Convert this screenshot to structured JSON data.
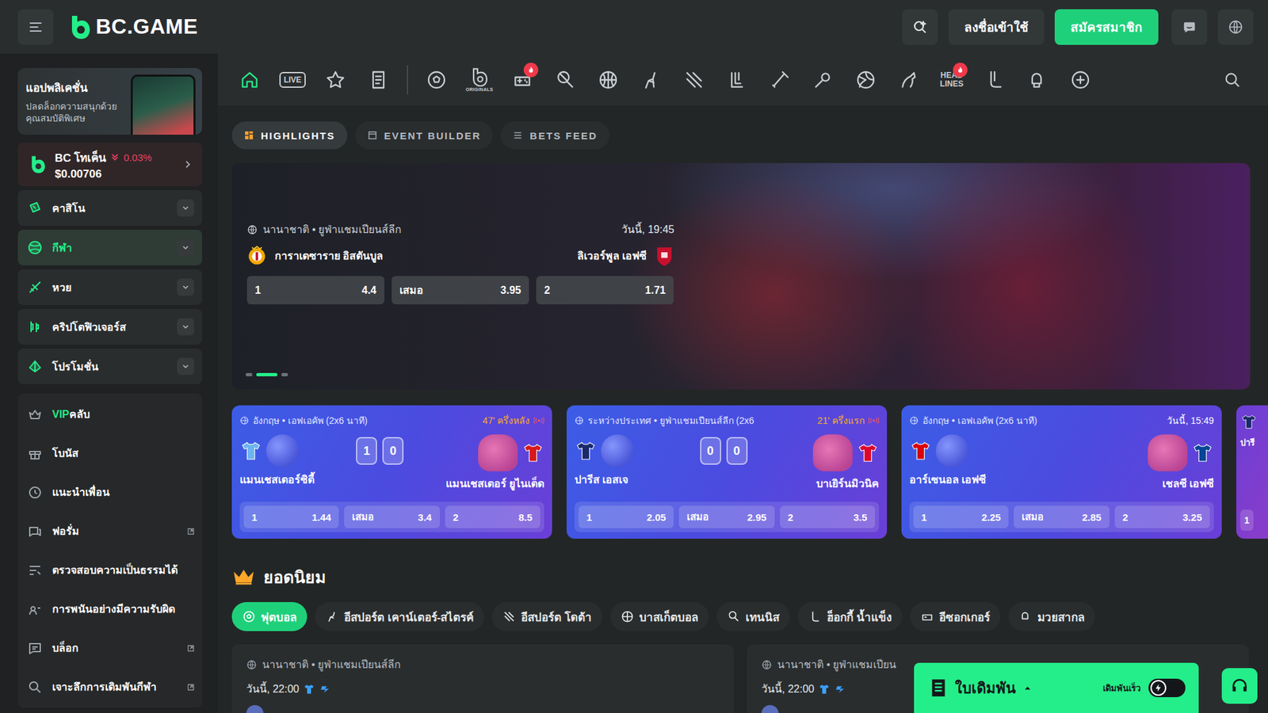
{
  "header": {
    "logo": "BC.GAME",
    "login": "ลงชื่อเข้าใช้",
    "signup": "สมัครสมาชิก"
  },
  "sidebar": {
    "app_promo": {
      "title": "แอปพลิเคชั่น",
      "subtitle": "ปลดล็อกความสนุกด้วยคุณสมบัติพิเศษ"
    },
    "token": {
      "name": "BC โทเค็น",
      "change": "0.03%",
      "price": "$0.00706",
      "falling": true
    },
    "groups": [
      {
        "label": "คาสิโน",
        "selected": false,
        "expanded": false
      },
      {
        "label": "กีฬา",
        "selected": true,
        "expanded": false
      },
      {
        "label": "หวย",
        "selected": false,
        "expanded": false
      },
      {
        "label": "คริปโตฟิวเจอร์ส",
        "selected": false,
        "expanded": false
      },
      {
        "label": "โปรโมชั่น",
        "selected": false,
        "expanded": false
      }
    ],
    "links": [
      {
        "accent": "VIP",
        "label": "คลับ",
        "external": false
      },
      {
        "accent": "",
        "label": "โบนัส",
        "external": false
      },
      {
        "accent": "",
        "label": "แนะนำเพื่อน",
        "external": false
      },
      {
        "accent": "",
        "label": "ฟอรั่ม",
        "external": true
      },
      {
        "accent": "",
        "label": "ตรวจสอบความเป็นธรรมได้",
        "external": false
      },
      {
        "accent": "",
        "label": "การพนันอย่างมีความรับผิด",
        "external": false
      },
      {
        "accent": "",
        "label": "บล็อก",
        "external": true
      },
      {
        "accent": "",
        "label": "เจาะลึกการเดิมพันกีฬา",
        "external": true
      }
    ]
  },
  "sports_nav": [
    {
      "kind": "home",
      "label": "",
      "selected": true,
      "hot": false
    },
    {
      "kind": "live",
      "label": "LIVE",
      "selected": false,
      "hot": false
    },
    {
      "kind": "star",
      "label": "",
      "selected": false,
      "hot": false
    },
    {
      "kind": "slip",
      "label": "",
      "selected": false,
      "hot": false
    },
    {
      "kind": "soccer",
      "label": "",
      "selected": false,
      "hot": false
    },
    {
      "kind": "originals",
      "label": "ORIGINALS",
      "selected": false,
      "hot": false
    },
    {
      "kind": "fifa",
      "label": "",
      "selected": false,
      "hot": true
    },
    {
      "kind": "tennis",
      "label": "",
      "selected": false,
      "hot": false
    },
    {
      "kind": "basketball",
      "label": "",
      "selected": false,
      "hot": false
    },
    {
      "kind": "cs",
      "label": "",
      "selected": false,
      "hot": false
    },
    {
      "kind": "dota",
      "label": "",
      "selected": false,
      "hot": false
    },
    {
      "kind": "lol",
      "label": "",
      "selected": false,
      "hot": false
    },
    {
      "kind": "cricket",
      "label": "",
      "selected": false,
      "hot": false
    },
    {
      "kind": "badminton",
      "label": "",
      "selected": false,
      "hot": false
    },
    {
      "kind": "volleyball",
      "label": "",
      "selected": false,
      "hot": false
    },
    {
      "kind": "horse",
      "label": "",
      "selected": false,
      "hot": false
    },
    {
      "kind": "headlines",
      "label": "HEAD LINES",
      "selected": false,
      "hot": true
    },
    {
      "kind": "hockey",
      "label": "",
      "selected": false,
      "hot": false
    },
    {
      "kind": "boxing",
      "label": "",
      "selected": false,
      "hot": false
    },
    {
      "kind": "more",
      "label": "",
      "selected": false,
      "hot": false
    }
  ],
  "tabs": [
    {
      "label": "HIGHLIGHTS",
      "selected": true
    },
    {
      "label": "EVENT BUILDER",
      "selected": false
    },
    {
      "label": "BETS FEED",
      "selected": false
    }
  ],
  "hero": {
    "league": "นานาชาติ • ยูฟ่าแชมเปียนส์ลีก",
    "time": "วันนี้, 19:45",
    "home": "การาเดซาราย อิสตันบูล",
    "away": "ลิเวอร์พูล เอฟซี",
    "home_color": "#f4a900",
    "away_color": "#c8102e",
    "odds": [
      {
        "label": "1",
        "value": "4.4"
      },
      {
        "label": "เสมอ",
        "value": "3.95"
      },
      {
        "label": "2",
        "value": "1.71"
      }
    ],
    "dots": [
      {
        "selected": false
      },
      {
        "selected": true
      },
      {
        "selected": false
      }
    ]
  },
  "match_cards": [
    {
      "kind": "full",
      "league": "อังกฤษ • เอฟเอคัพ (2x6 นาที)",
      "status": "47' ครึ่งหลัง",
      "live": true,
      "home": "แมนเชสเตอร์ซิตี้",
      "away": "แมนเชสเตอร์ ยูไนเต็ด",
      "home_score": "1",
      "away_score": "0",
      "home_color": "#6cb4ee",
      "away_color": "#d7191c",
      "odds": [
        {
          "label": "1",
          "value": "1.44"
        },
        {
          "label": "เสมอ",
          "value": "3.4"
        },
        {
          "label": "2",
          "value": "8.5"
        }
      ]
    },
    {
      "kind": "full",
      "league": "ระหว่างประเทศ • ยูฟ่าแชมเปียนส์ลีก (2x6",
      "status": "21' ครึ่งแรก",
      "live": true,
      "home": "ปารีส เอสเจ",
      "away": "บาเยิร์นมิวนิค",
      "home_score": "0",
      "away_score": "0",
      "home_color": "#1b2a6b",
      "away_color": "#dc052d",
      "odds": [
        {
          "label": "1",
          "value": "2.05"
        },
        {
          "label": "เสมอ",
          "value": "2.95"
        },
        {
          "label": "2",
          "value": "3.5"
        }
      ]
    },
    {
      "kind": "full",
      "league": "อังกฤษ • เอฟเอคัพ (2x6 นาที)",
      "status": "วันนี้, 15:49",
      "live": false,
      "home": "อาร์เซนอล เอฟซี",
      "away": "เชลซี เอฟซี",
      "home_score": "",
      "away_score": "",
      "home_color": "#db0007",
      "away_color": "#034694",
      "odds": [
        {
          "label": "1",
          "value": "2.25"
        },
        {
          "label": "เสมอ",
          "value": "2.85"
        },
        {
          "label": "2",
          "value": "3.25"
        }
      ]
    },
    {
      "kind": "peek",
      "league": "",
      "status": "",
      "live": false,
      "home": "ปารี",
      "away": "",
      "home_score": "",
      "away_score": "",
      "home_color": "#1b2a6b",
      "away_color": "#1b2a6b",
      "odds": [
        {
          "label": "1",
          "value": ""
        }
      ]
    }
  ],
  "popular": {
    "title": "ยอดนิยม",
    "chips": [
      {
        "label": "ฟุตบอล",
        "selected": true
      },
      {
        "label": "อีสปอร์ต เคาน์เตอร์-สไตรค์",
        "selected": false
      },
      {
        "label": "อีสปอร์ต โดต้า",
        "selected": false
      },
      {
        "label": "บาสเก็ตบอล",
        "selected": false
      },
      {
        "label": "เทนนิส",
        "selected": false
      },
      {
        "label": "ฮ็อกกี้ น้ำแข็ง",
        "selected": false
      },
      {
        "label": "อีซอกเกอร์",
        "selected": false
      },
      {
        "label": "มวยสากล",
        "selected": false
      }
    ],
    "events": [
      {
        "league": "นานาชาติ • ยูฟ่าแชมเปียนส์ลีก",
        "time": "วันนี้, 22:00"
      },
      {
        "league": "นานาชาติ • ยูฟ่าแชมเปียน",
        "time": "วันนี้, 22:00"
      }
    ]
  },
  "bet_slip": {
    "title": "ใบเดิมพัน",
    "quick_label": "เดิมพันเร็ว",
    "quick_on": false
  }
}
